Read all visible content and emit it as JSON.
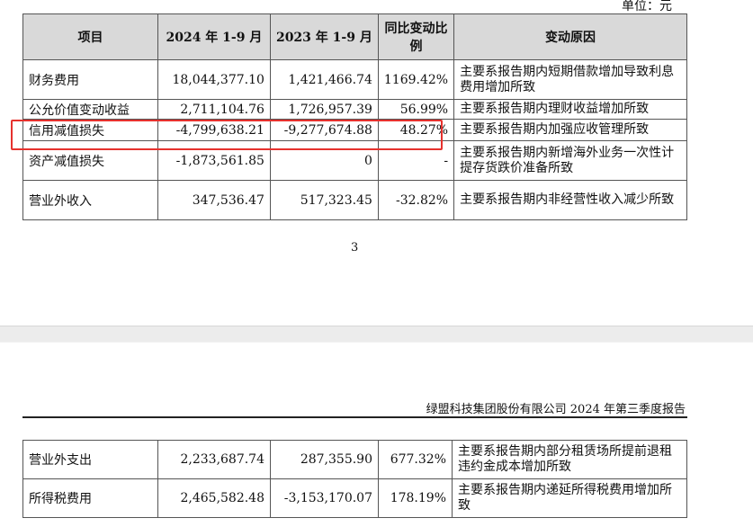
{
  "unit_label": "单位：元",
  "table1": {
    "headers": [
      "项目",
      "2024 年 1-9 月",
      "2023 年 1-9 月",
      "同比变动比例",
      "变动原因"
    ],
    "rows": [
      {
        "item": "财务费用",
        "y2024": "18,044,377.10",
        "y2023": "1,421,466.74",
        "change": "1169.42%",
        "reason": "主要系报告期内短期借款增加导致利息费用增加所致"
      },
      {
        "item": "公允价值变动收益",
        "y2024": "2,711,104.76",
        "y2023": "1,726,957.39",
        "change": "56.99%",
        "reason": "主要系报告期内理财收益增加所致"
      },
      {
        "item": "信用减值损失",
        "y2024": "-4,799,638.21",
        "y2023": "-9,277,674.88",
        "change": "48.27%",
        "reason": "主要系报告期内加强应收管理所致"
      },
      {
        "item": "资产减值损失",
        "y2024": "-1,873,561.85",
        "y2023": "0",
        "change": "-",
        "reason": "主要系报告期内新增海外业务一次性计提存货跌价准备所致"
      },
      {
        "item": "营业外收入",
        "y2024": "347,536.47",
        "y2023": "517,323.45",
        "change": "-32.82%",
        "reason": "主要系报告期内非经营性收入减少所致"
      }
    ]
  },
  "page_number": "3",
  "doc_header": "绿盟科技集团股份有限公司 2024 年第三季度报告",
  "table2": {
    "rows": [
      {
        "item": "营业外支出",
        "y2024": "2,233,687.74",
        "y2023": "287,355.90",
        "change": "677.32%",
        "reason": "主要系报告期内部分租赁场所提前退租违约金成本增加所致"
      },
      {
        "item": "所得税费用",
        "y2024": "2,465,582.48",
        "y2023": "-3,153,170.07",
        "change": "178.19%",
        "reason": "主要系报告期内递延所得税费用增加所致"
      }
    ]
  },
  "highlight_color": "#e6322e"
}
